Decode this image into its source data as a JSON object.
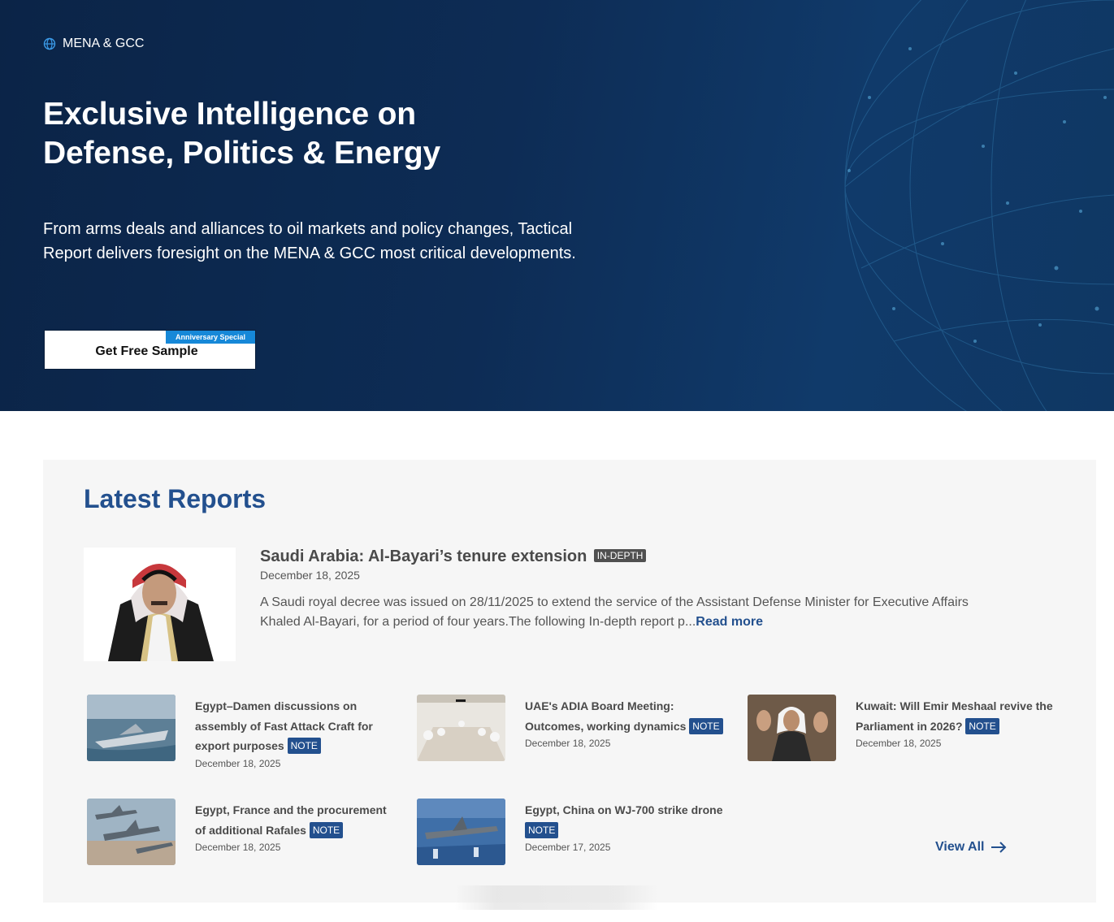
{
  "hero": {
    "region_label": "MENA & GCC",
    "title_line1": "Exclusive Intelligence on",
    "title_line2": "Defense, Politics & Energy",
    "description": "From arms deals and alliances to oil markets and policy changes, Tactical Report delivers foresight on the MENA & GCC most critical developments.",
    "cta_label": "Get Free Sample",
    "cta_badge": "Anniversary Special"
  },
  "reports": {
    "heading": "Latest Reports",
    "featured": {
      "title": "Saudi Arabia: Al-Bayari’s tenure extension",
      "badge": "IN-DEPTH",
      "date": "December 18, 2025",
      "excerpt": "A Saudi royal decree was issued on 28/11/2025 to extend the service of the Assistant Defense Minister for Executive Affairs Khaled Al-Bayari, for a period of four years.The following In-depth report p...",
      "read_more": "Read more"
    },
    "items": [
      {
        "title": "Egypt–Damen discussions on assembly of Fast Attack Craft for export purposes",
        "badge": "NOTE",
        "date": "December 18, 2025"
      },
      {
        "title": "UAE's ADIA Board Meeting: Outcomes, working dynamics",
        "badge": "NOTE",
        "date": "December 18, 2025"
      },
      {
        "title": "Kuwait: Will Emir Meshaal revive the Parliament in 2026?",
        "badge": "NOTE",
        "date": "December 18, 2025"
      },
      {
        "title": "Egypt, France and the procurement of additional Rafales",
        "badge": "NOTE",
        "date": "December 18, 2025"
      },
      {
        "title": "Egypt, China on WJ-700 strike drone",
        "badge": "NOTE",
        "date": "December 17, 2025"
      }
    ],
    "view_all": "View All"
  },
  "colors": {
    "hero_bg": "#0d2c55",
    "accent_blue": "#23508e",
    "badge_blue": "#1688d8",
    "panel_bg": "#f6f6f6"
  }
}
